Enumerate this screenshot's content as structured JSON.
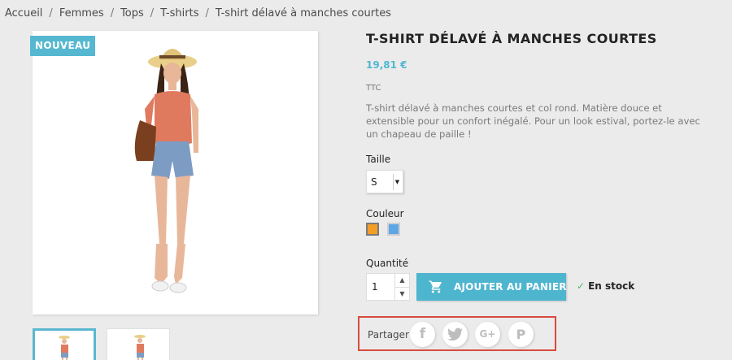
{
  "breadcrumb": [
    "Accueil",
    "Femmes",
    "Tops",
    "T-shirts",
    "T-shirt délavé à manches courtes"
  ],
  "badge": "NOUVEAU",
  "product": {
    "title": "T-SHIRT DÉLAVÉ À MANCHES COURTES",
    "price": "19,81 €",
    "tax": "TTC",
    "description": "T-shirt délavé à manches courtes et col rond. Matière douce et extensible pour un confort inégalé. Pour un look estival, portez-le avec un chapeau de paille !"
  },
  "size": {
    "label": "Taille",
    "value": "S"
  },
  "color": {
    "label": "Couleur",
    "swatches": [
      "#f39d27",
      "#5da7e8"
    ]
  },
  "quantity": {
    "label": "Quantité",
    "value": "1"
  },
  "cart_button": "AJOUTER AU PANIER",
  "stock": "En stock",
  "share": {
    "label": "Partager",
    "networks": [
      "facebook-icon",
      "twitter-icon",
      "google-plus-icon",
      "pinterest-icon"
    ]
  }
}
